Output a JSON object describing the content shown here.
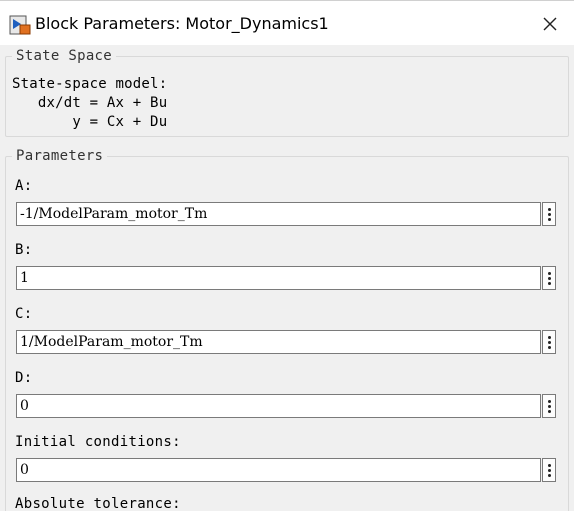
{
  "window": {
    "title": "Block Parameters: Motor_Dynamics1",
    "app_icon": "simulink-block-icon",
    "close_icon": "close-icon"
  },
  "state_space_group": {
    "title": "State Space",
    "description": [
      "State-space model:",
      "   dx/dt = Ax + Bu",
      "       y = Cx + Du"
    ]
  },
  "parameters_group": {
    "title": "Parameters",
    "fields": [
      {
        "label": "A:",
        "value": "-1/ModelParam_motor_Tm"
      },
      {
        "label": "B:",
        "value": "1"
      },
      {
        "label": "C:",
        "value": "1/ModelParam_motor_Tm"
      },
      {
        "label": "D:",
        "value": "0"
      },
      {
        "label": "Initial conditions:",
        "value": "0"
      },
      {
        "label": "Absolute tolerance:"
      }
    ],
    "action_icon": "vertical-ellipsis-icon"
  }
}
